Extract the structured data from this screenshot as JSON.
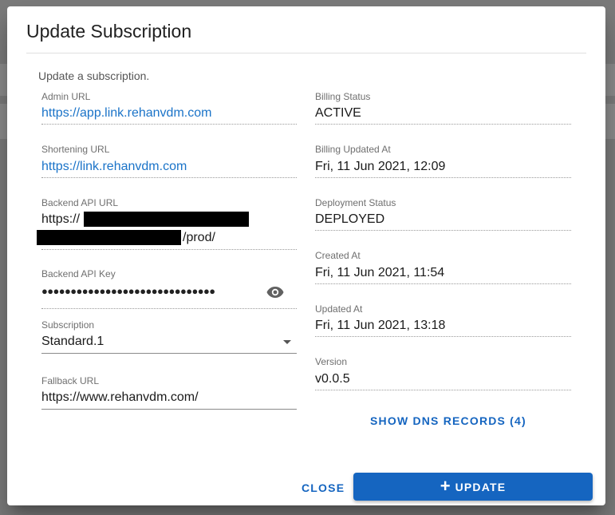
{
  "dialog": {
    "title": "Update Subscription",
    "description": "Update a subscription."
  },
  "left_fields": {
    "admin_url": {
      "label": "Admin URL",
      "value": "https://app.link.rehanvdm.com"
    },
    "shortening_url": {
      "label": "Shortening URL",
      "value": "https://link.rehanvdm.com"
    },
    "backend_api_url": {
      "label": "Backend API URL",
      "value_start": "https://",
      "value_end": "/prod/"
    },
    "backend_api_key": {
      "label": "Backend API Key",
      "masked_value": "●●●●●●●●●●●●●●●●●●●●●●●●●●●●●●",
      "toggle_icon": "eye-icon"
    },
    "subscription": {
      "label": "Subscription",
      "selected": "Standard.1"
    },
    "fallback_url": {
      "label": "Fallback URL",
      "value": "https://www.rehanvdm.com/"
    }
  },
  "right_fields": {
    "billing_status": {
      "label": "Billing Status",
      "value": "ACTIVE"
    },
    "billing_updated_at": {
      "label": "Billing Updated At",
      "value": "Fri, 11 Jun 2021, 12:09"
    },
    "deployment_status": {
      "label": "Deployment Status",
      "value": "DEPLOYED"
    },
    "created_at": {
      "label": "Created At",
      "value": "Fri, 11 Jun 2021, 11:54"
    },
    "updated_at": {
      "label": "Updated At",
      "value": "Fri, 11 Jun 2021, 13:18"
    },
    "version": {
      "label": "Version",
      "value": "v0.0.5"
    }
  },
  "actions": {
    "show_dns": "SHOW DNS RECORDS (4)",
    "close": "CLOSE",
    "update": "UPDATE"
  },
  "colors": {
    "primary": "#1565c0",
    "link": "#1a73c8"
  }
}
